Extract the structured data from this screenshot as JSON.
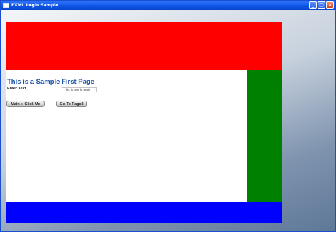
{
  "window": {
    "title": "FXML Login Sample",
    "buttons": {
      "minimize": "_",
      "maximize": "□",
      "close": "×"
    }
  },
  "page": {
    "heading": "This is a Sample First Page",
    "text_label": "Enter Text",
    "text_value": "This is text in main",
    "main_button": "Main :: Click Me",
    "page2_button": "Go To Page2"
  },
  "colors": {
    "top_band": "#ff0000",
    "right_band": "#008000",
    "bottom_band": "#0000ff"
  }
}
